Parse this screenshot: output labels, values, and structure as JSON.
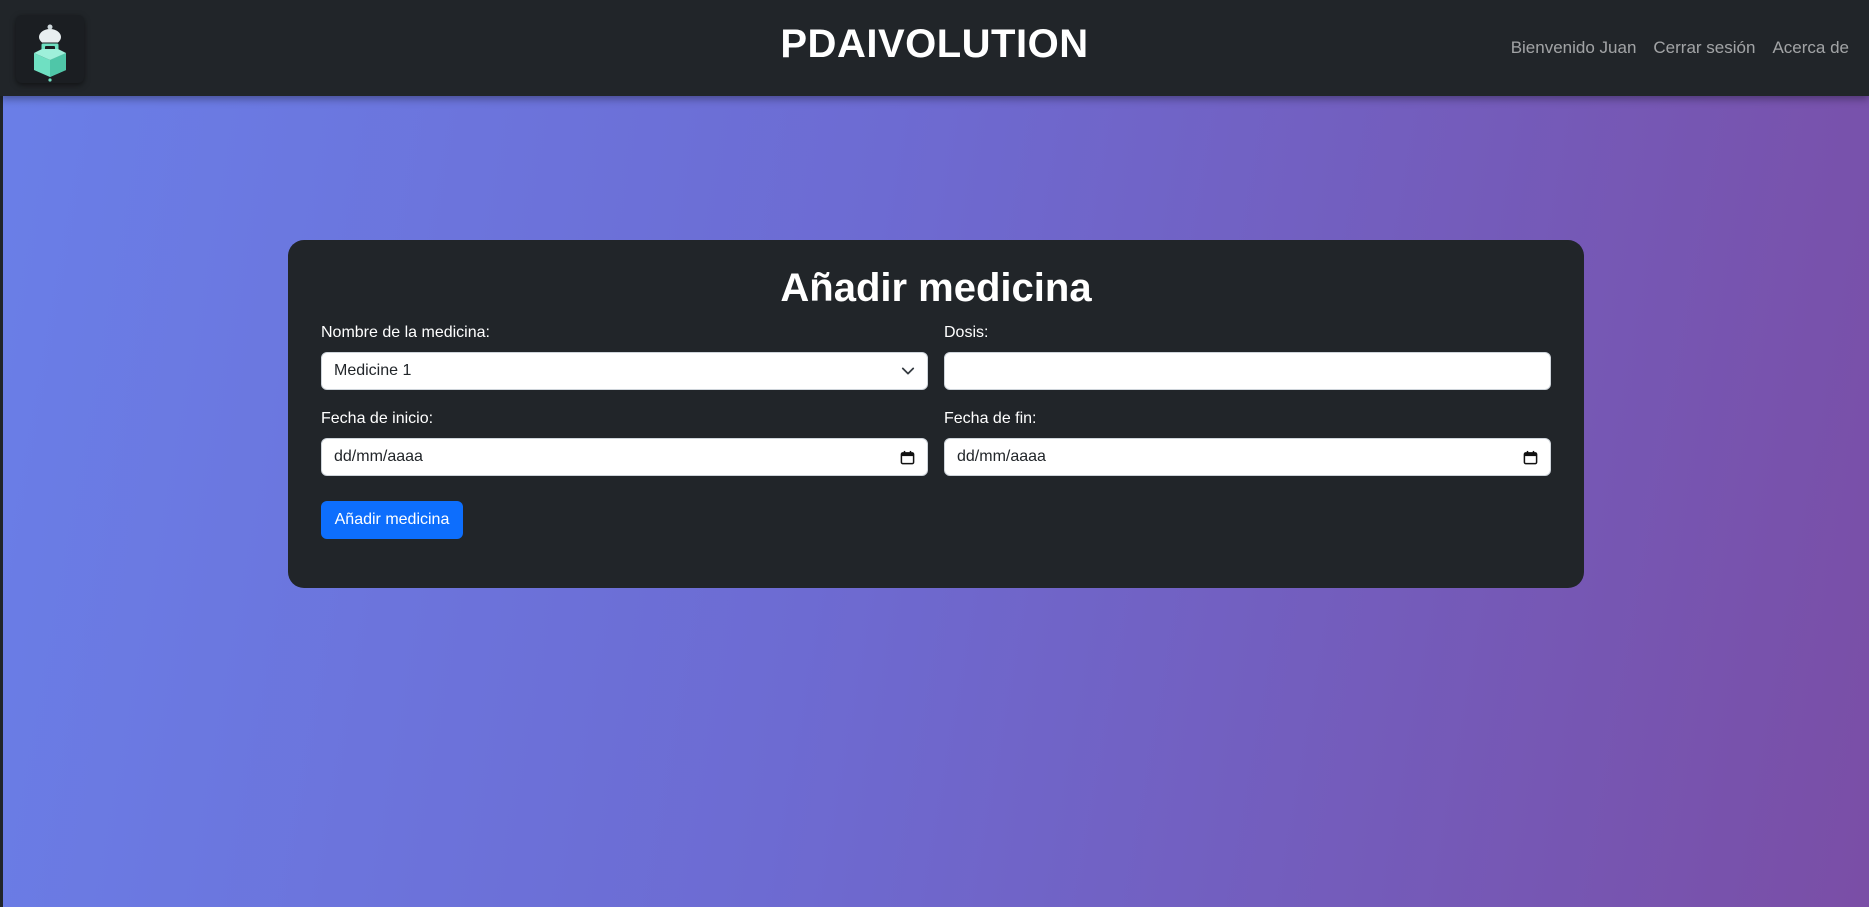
{
  "header": {
    "brand": "PDAIVOLUTION",
    "logo_icon": "robot-logo-icon",
    "nav": [
      {
        "label": "Bienvenido Juan"
      },
      {
        "label": "Cerrar sesión"
      },
      {
        "label": "Acerca de"
      }
    ]
  },
  "form": {
    "title": "Añadir medicina",
    "medicine_label": "Nombre de la medicina:",
    "medicine_value": "Medicine 1",
    "dose_label": "Dosis:",
    "dose_value": "",
    "start_label": "Fecha de inicio:",
    "start_value": "dd/mm/aaaa",
    "end_label": "Fecha de fin:",
    "end_value": "dd/mm/aaaa",
    "submit_label": "Añadir medicina"
  },
  "colors": {
    "navbar": "#212529",
    "card": "#212529",
    "button": "#0d6efd",
    "gradient_start": "#6a7fe8",
    "gradient_end": "#7a4ea6"
  }
}
